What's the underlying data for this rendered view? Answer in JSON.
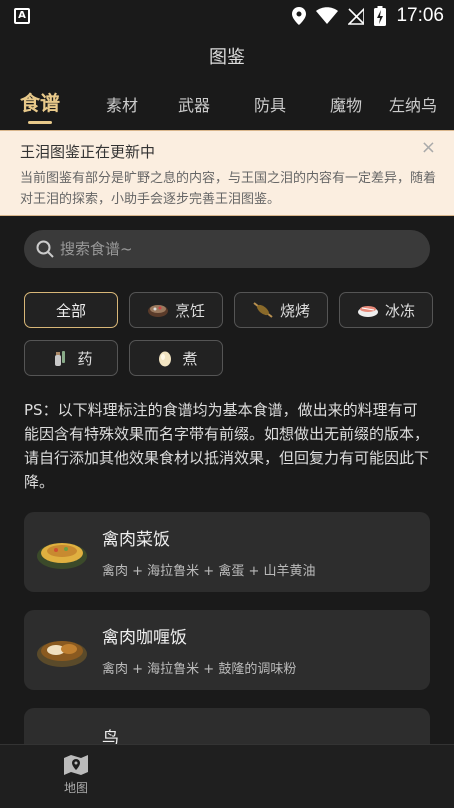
{
  "status": {
    "time": "17:06"
  },
  "header": {
    "title": "图鉴"
  },
  "tabs": [
    {
      "label": "食谱"
    },
    {
      "label": "素材"
    },
    {
      "label": "武器"
    },
    {
      "label": "防具"
    },
    {
      "label": "魔物"
    },
    {
      "label": "左纳乌"
    }
  ],
  "notice": {
    "title": "王泪图鉴正在更新中",
    "body": "当前图鉴有部分是旷野之息的内容，与王国之泪的内容有一定差异，随着对王泪的探索，小助手会逐步完善王泪图鉴。",
    "close": "×"
  },
  "search": {
    "placeholder": "搜索食谱~"
  },
  "filters": [
    {
      "label": "全部",
      "icon": ""
    },
    {
      "label": "烹饪",
      "icon": "pot-icon"
    },
    {
      "label": "烧烤",
      "icon": "skewer-icon"
    },
    {
      "label": "冰冻",
      "icon": "sushi-icon"
    },
    {
      "label": "药",
      "icon": "potion-icon"
    },
    {
      "label": "煮",
      "icon": "egg-icon"
    }
  ],
  "ps_text": "PS：以下料理标注的食谱均为基本食谱，做出来的料理有可能因含有特殊效果而名字带有前缀。如想做出无前缀的版本，请自行添加其他效果食材以抵消效果，但回复力有可能因此下降。",
  "recipes": [
    {
      "name": "禽肉菜饭",
      "ingredients": "禽肉 + 海拉鲁米 + 禽蛋 + 山羊黄油"
    },
    {
      "name": "禽肉咖喱饭",
      "ingredients": "禽肉 + 海拉鲁米 + 鼓隆的调味粉"
    },
    {
      "name": "鸟",
      "ingredients": ""
    }
  ],
  "bottom_nav": {
    "map_label": "地图"
  },
  "colors": {
    "accent": "#e8c98a",
    "background": "#1a1a1a",
    "card": "#2d2d2d",
    "notice_bg": "#fbeee0"
  }
}
